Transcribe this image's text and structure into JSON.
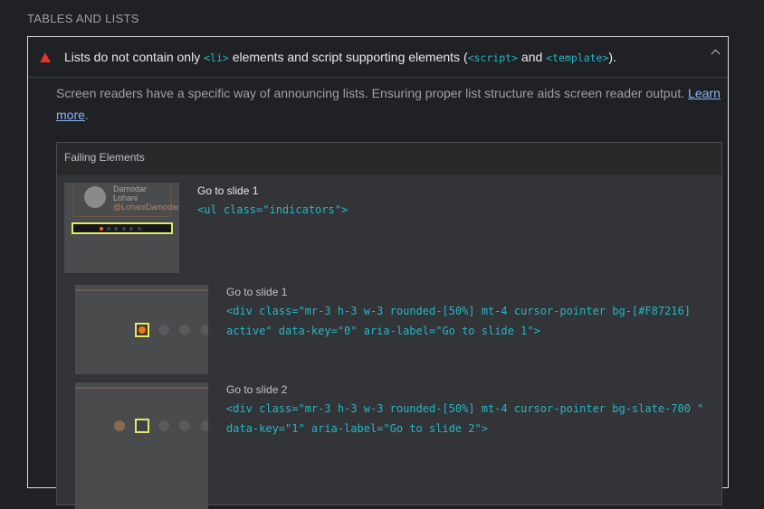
{
  "section_title": "TABLES AND LISTS",
  "audit": {
    "status_icon": "fail-triangle-icon",
    "status_color": "#eb3223",
    "title_parts": [
      "Lists do not contain only ",
      "<li>",
      " elements and script supporting elements (",
      "<script>",
      " and ",
      "<template>",
      ")."
    ],
    "description": "Screen readers have a specific way of announcing lists. Ensuring proper list structure aids screen reader output.",
    "learn_more": "Learn more",
    "table_header": "Failing Elements",
    "items": [
      {
        "label": "Go to slide 1",
        "snippet": "<ul class=\"indicators\">",
        "thumb_text": [
          "Damodar",
          "Lohani",
          "@LohaniDamodar"
        ]
      },
      {
        "label": "Go to slide 1",
        "snippet": "<div class=\"mr-3 h-3 w-3 rounded-[50%] mt-4 cursor-pointer bg-[#F87216] active\" data-key=\"0\" aria-label=\"Go to slide 1\">"
      },
      {
        "label": "Go to slide 2",
        "snippet": "<div class=\"mr-3 h-3 w-3 rounded-[50%] mt-4 cursor-pointer bg-slate-700 \" data-key=\"1\" aria-label=\"Go to slide 2\">"
      }
    ]
  }
}
